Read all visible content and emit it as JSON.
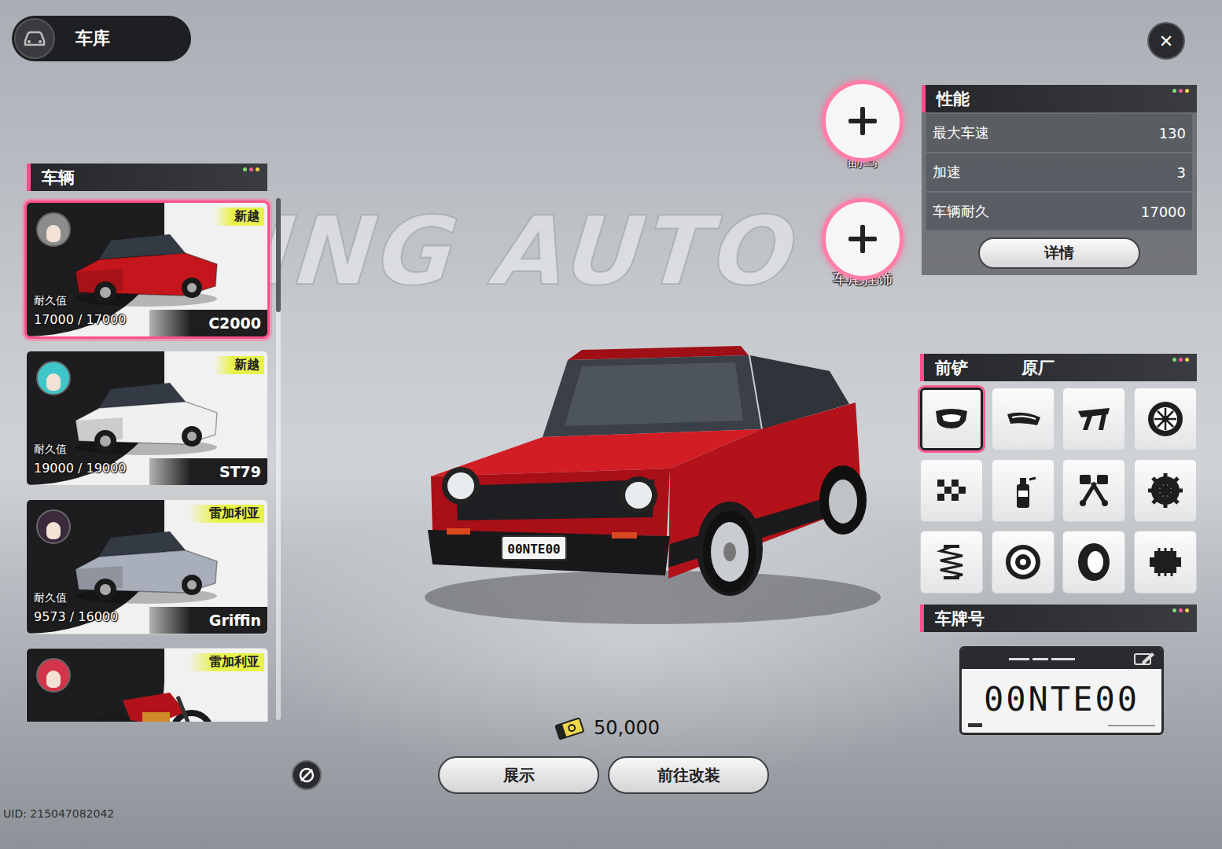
{
  "garage": {
    "title": "车库"
  },
  "close": {
    "label": "✕"
  },
  "vehicles": {
    "title": "车辆",
    "items": [
      {
        "name": "C2000",
        "brand": "新越",
        "durability_label": "耐久值",
        "durability": "17000 / 17000",
        "selected": true,
        "kind": "car",
        "color": "#c4161c",
        "avatar_color": "#8c8c8c"
      },
      {
        "name": "ST79",
        "brand": "新越",
        "durability_label": "耐久值",
        "durability": "19000 / 19000",
        "selected": false,
        "kind": "car",
        "color": "#eef0f2",
        "avatar_color": "#3fc6c9"
      },
      {
        "name": "Griffin",
        "brand": "雷加利亚",
        "durability_label": "耐久值",
        "durability": "9573 / 16000",
        "selected": false,
        "kind": "car",
        "color": "#a9aebb",
        "avatar_color": "#3a2a3c"
      },
      {
        "brand": "雷加利亚",
        "selected": false,
        "kind": "motorcycle",
        "color": "#b3121a",
        "avatar_color": "#d2344a"
      }
    ]
  },
  "watermark": "ING AUTO",
  "slots": [
    {
      "label": "副驾"
    },
    {
      "label": "车尾挂饰"
    }
  ],
  "performance": {
    "title": "性能",
    "stats": [
      {
        "label": "最大车速",
        "value": "130"
      },
      {
        "label": "加速",
        "value": "3"
      },
      {
        "label": "车辆耐久",
        "value": "17000"
      }
    ],
    "details_button": "详情"
  },
  "parts": {
    "title": "前铲",
    "value": "原厂",
    "tiles": [
      {
        "selected": true
      },
      {
        "selected": false
      },
      {
        "selected": false
      },
      {
        "selected": false
      },
      {
        "selected": false
      },
      {
        "selected": false
      },
      {
        "selected": false
      },
      {
        "selected": false
      },
      {
        "selected": false
      },
      {
        "selected": false
      },
      {
        "selected": false
      },
      {
        "selected": false
      }
    ]
  },
  "plate": {
    "title": "车牌号",
    "number": "00NTE00"
  },
  "currency": {
    "amount": "50,000"
  },
  "buttons": [
    {
      "label": "展示"
    },
    {
      "label": "前往改装"
    }
  ],
  "uid": "UID: 215047082042"
}
